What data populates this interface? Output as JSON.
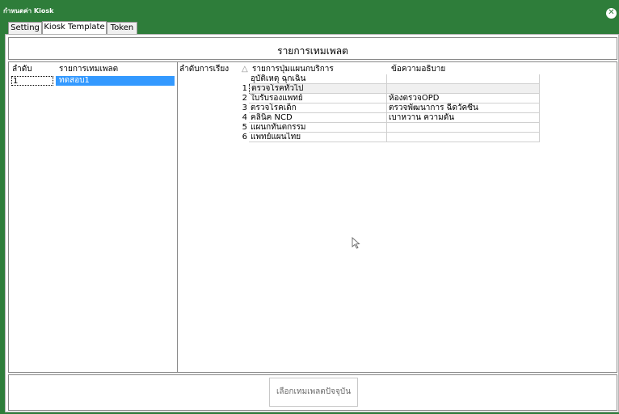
{
  "window": {
    "title": "กำหนดค่า Kiosk",
    "close_glyph": "✕"
  },
  "tabs": [
    {
      "label": "Setting",
      "active": false
    },
    {
      "label": "Kiosk Template",
      "active": true
    },
    {
      "label": "Token",
      "active": false
    }
  ],
  "header": {
    "title": "รายการเทมเพลต"
  },
  "template_list": {
    "columns": [
      "ลำดับ",
      "รายการเทมเพลต"
    ],
    "rows": [
      {
        "order": "1",
        "name": "ทดสอบ1"
      }
    ]
  },
  "button_grid": {
    "columns": [
      "ลำดับการเรียง",
      "△",
      "รายการปุ่มแผนกบริการ",
      "ข้อความอธิบาย"
    ],
    "rows": [
      {
        "order": "",
        "name": "อุบัติเหตุ ฉุกเฉิน",
        "desc": ""
      },
      {
        "order": "1",
        "name": "ตรวจโรคทั่วไป",
        "desc": ""
      },
      {
        "order": "2",
        "name": "ใบรับรองแพทย์",
        "desc": "ห้องตรวจOPD"
      },
      {
        "order": "3",
        "name": "ตรวจโรคเด็ก",
        "desc": "ตรวจพัฒนาการ ฉีดวัคซีน"
      },
      {
        "order": "4",
        "name": "คลินิค NCD",
        "desc": "เบาหวาน ความดัน"
      },
      {
        "order": "5",
        "name": "แผนกทันตกรรม",
        "desc": ""
      },
      {
        "order": "6",
        "name": "แพทย์แผนไทย",
        "desc": ""
      }
    ]
  },
  "footer": {
    "select_button": "เลือกเทมเพลตปัจจุบัน"
  },
  "colors": {
    "titlebar": "#2e7d3a",
    "selection": "#3399ff"
  }
}
